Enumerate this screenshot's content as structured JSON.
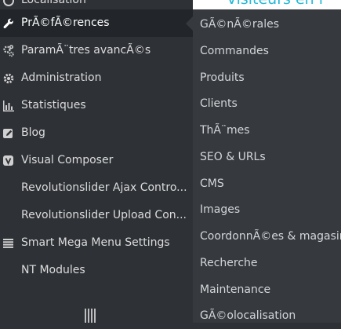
{
  "header": {
    "visitor_text": "Visiteurs en l"
  },
  "sidebar": {
    "items": [
      {
        "label": "Localisation",
        "icon": "globe-icon"
      },
      {
        "label": "PrÃ©fÃ©rences",
        "icon": "wrench-icon",
        "active": true
      },
      {
        "label": "ParamÃ¨tres avancÃ©s",
        "icon": "cogs-icon"
      },
      {
        "label": "Administration",
        "icon": "gear-icon"
      },
      {
        "label": "Statistiques",
        "icon": "bar-chart-icon"
      },
      {
        "label": "Blog",
        "icon": "edit-icon"
      },
      {
        "label": "Visual Composer",
        "icon": "vc-icon"
      },
      {
        "label": "Revolutionslider Ajax Contro...",
        "icon": ""
      },
      {
        "label": "Revolutionslider Upload Con...",
        "icon": ""
      },
      {
        "label": "Smart Mega Menu Settings",
        "icon": "list-icon"
      },
      {
        "label": "NT Modules",
        "icon": ""
      }
    ]
  },
  "submenu": {
    "items": [
      "GÃ©nÃ©rales",
      "Commandes",
      "Produits",
      "Clients",
      "ThÃ¨mes",
      "SEO & URLs",
      "CMS",
      "Images",
      "CoordonnÃ©es & magasins",
      "Recherche",
      "Maintenance",
      "GÃ©olocalisation"
    ]
  },
  "colors": {
    "sidebar_bg": "#2e3136",
    "submenu_bg": "#363a3f",
    "accent": "#25b9d7"
  }
}
